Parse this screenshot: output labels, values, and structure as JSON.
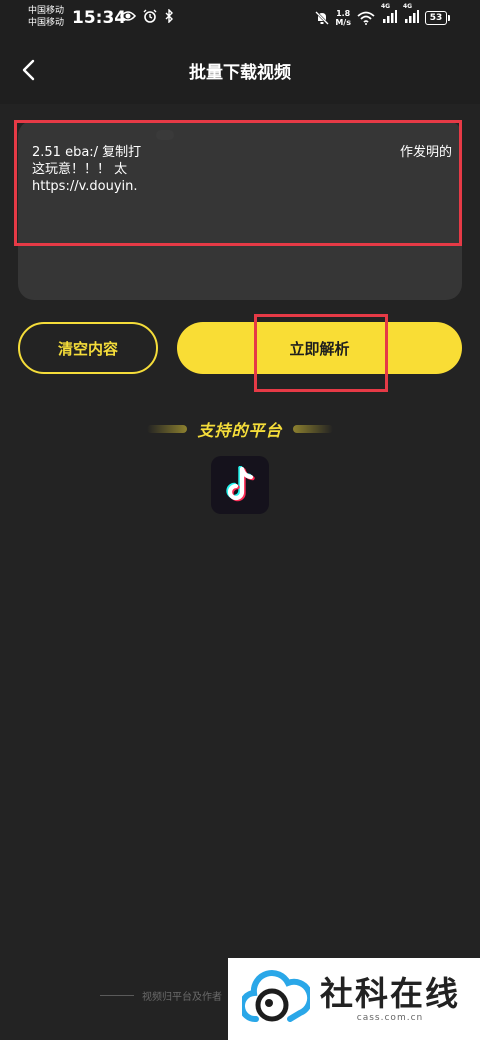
{
  "status_bar": {
    "carrier_1": "中国移动",
    "carrier_2": "中国移动",
    "time": "15:34",
    "net_speed_value": "1.8",
    "net_speed_unit": "M/s",
    "signal_1_label": "4G",
    "signal_2_label": "4G",
    "battery_level": "53"
  },
  "header": {
    "title": "批量下载视频"
  },
  "input": {
    "line_1_start": "2.51 eba:/ 复制打",
    "line_1_end": "作发明的",
    "line_2": "这玩意！！！ 太",
    "line_3": "https://v.douyin."
  },
  "actions": {
    "clear_label": "清空内容",
    "parse_label": "立即解析"
  },
  "platforms": {
    "title": "支持的平台",
    "items": [
      {
        "icon": "tiktok-icon"
      }
    ]
  },
  "footer": {
    "note": "视频归平台及作者"
  },
  "watermark": {
    "name": "社科在线",
    "domain": "cass.com.cn"
  },
  "colors": {
    "accent_yellow": "#f9dd35",
    "background": "#232323",
    "annotation_red": "#e63a46"
  }
}
